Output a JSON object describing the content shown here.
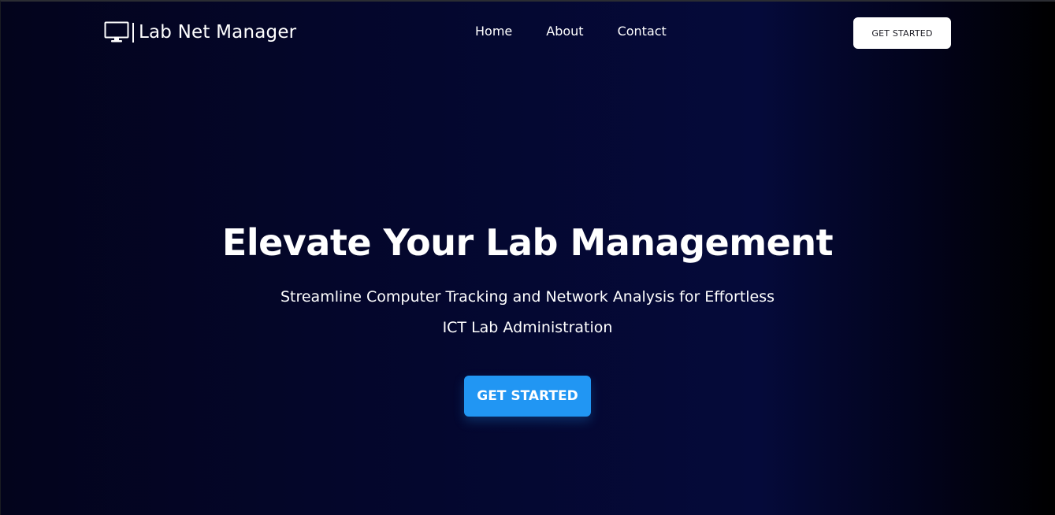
{
  "brand": {
    "name": "Lab Net Manager",
    "icon": "monitor-icon"
  },
  "nav": {
    "items": [
      "Home",
      "About",
      "Contact"
    ]
  },
  "header": {
    "cta_label": "GET STARTED"
  },
  "hero": {
    "title": "Elevate Your Lab Management",
    "subtitle": "Streamline Computer Tracking and Network Analysis for Effortless ICT Lab Administration",
    "cta_label": "GET STARTED"
  },
  "colors": {
    "background": "#03041c",
    "accent": "#2196f3",
    "text": "#ffffff"
  }
}
